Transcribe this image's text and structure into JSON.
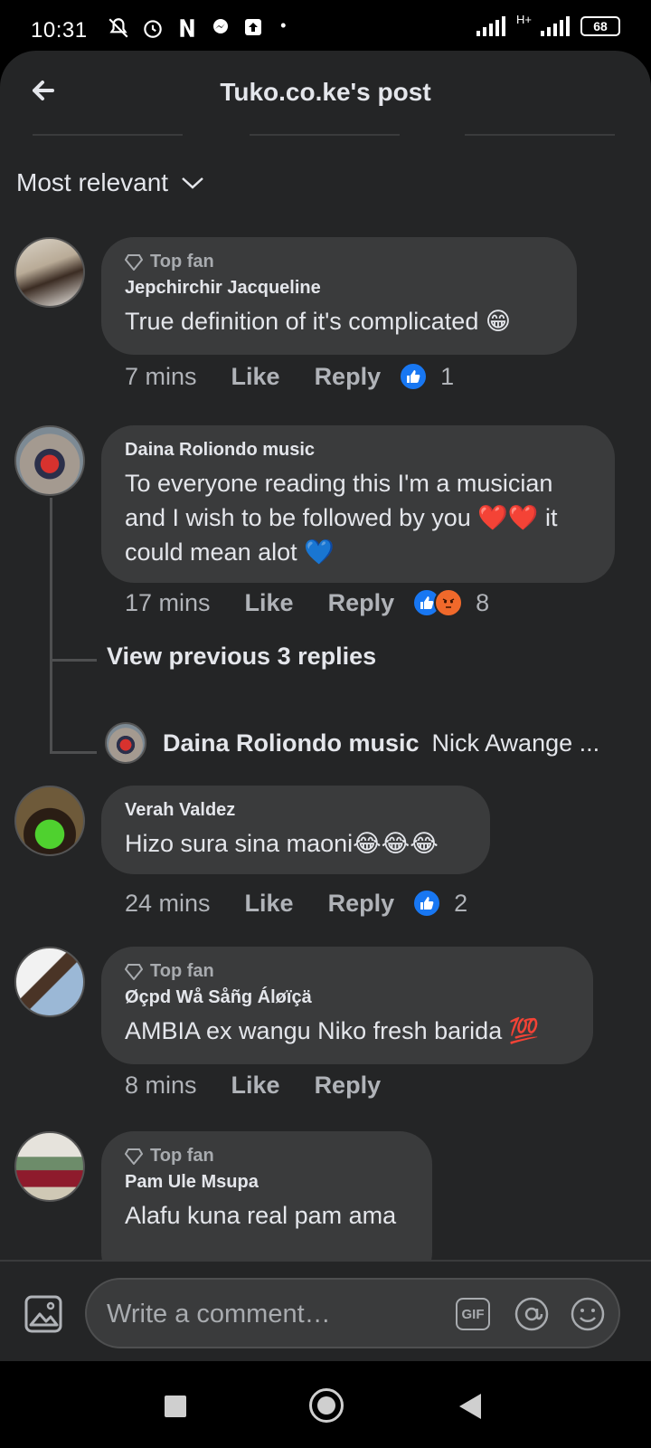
{
  "status_bar": {
    "time": "10:31",
    "network": "H+",
    "battery": "68"
  },
  "header": {
    "title": "Tuko.co.ke's post"
  },
  "sort": {
    "label": "Most relevant"
  },
  "comments": [
    {
      "badge": "Top fan",
      "author": "Jepchirchir Jacqueline",
      "text": "True definition of it's complicated 😁",
      "time": "7 mins",
      "like": "Like",
      "reply": "Reply",
      "reactions": [
        "like"
      ],
      "reaction_count": "1"
    },
    {
      "badge": "",
      "author": "Daina Roliondo music",
      "text": "To everyone reading this I'm a musician and I wish to be followed by you ❤️❤️ it could mean alot 💙",
      "time": "17 mins",
      "like": "Like",
      "reply": "Reply",
      "reactions": [
        "like",
        "angry"
      ],
      "reaction_count": "8"
    },
    {
      "badge": "",
      "author": "Verah Valdez",
      "text": "Hizo sura sina maoni😂😂😂",
      "time": "24 mins",
      "like": "Like",
      "reply": "Reply",
      "reactions": [
        "like"
      ],
      "reaction_count": "2"
    },
    {
      "badge": "Top fan",
      "author": "Øçpd Wå Såñg Áløïçä",
      "text": "AMBIA ex wangu Niko fresh barida 💯",
      "time": "8 mins",
      "like": "Like",
      "reply": "Reply",
      "reactions": [],
      "reaction_count": ""
    },
    {
      "badge": "Top fan",
      "author": "Pam Ule Msupa",
      "text": "Alafu kuna real pam ama"
    }
  ],
  "thread": {
    "view_previous": "View previous 3 replies",
    "last_reply_author": "Daina Roliondo music",
    "last_reply_text": "Nick Awange ..."
  },
  "composer": {
    "placeholder": "Write a comment…",
    "gif_label": "GIF"
  },
  "colors": {
    "background": "#242526",
    "bubble": "#3a3b3c",
    "like_blue": "#1877f2",
    "angry_orange": "#f0692b"
  }
}
